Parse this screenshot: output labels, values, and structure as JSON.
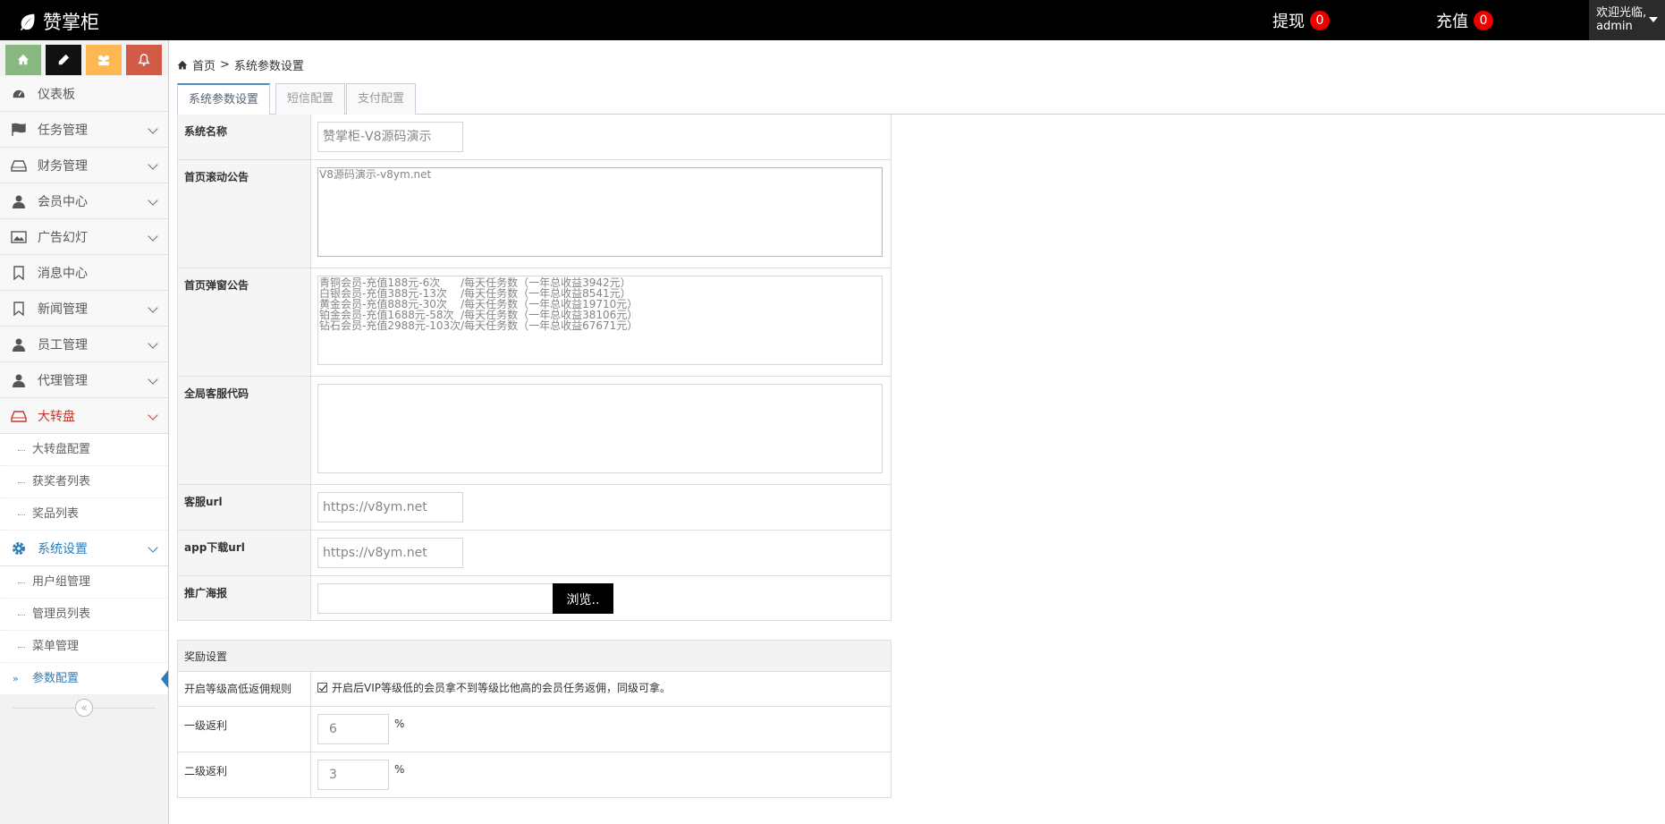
{
  "header": {
    "brand": "赞掌柜",
    "withdraw_label": "提现",
    "withdraw_count": "0",
    "recharge_label": "充值",
    "recharge_count": "0",
    "welcome": "欢迎光临,",
    "username": "admin"
  },
  "sidebar": {
    "items": [
      {
        "label": "仪表板",
        "icon": "dashboard-icon"
      },
      {
        "label": "任务管理",
        "icon": "flag-icon"
      },
      {
        "label": "财务管理",
        "icon": "hdd-icon"
      },
      {
        "label": "会员中心",
        "icon": "user-icon"
      },
      {
        "label": "广告幻灯",
        "icon": "picture-icon"
      },
      {
        "label": "消息中心",
        "icon": "bookmark-icon"
      },
      {
        "label": "新闻管理",
        "icon": "bookmark-icon"
      },
      {
        "label": "员工管理",
        "icon": "user-icon"
      },
      {
        "label": "代理管理",
        "icon": "user-icon"
      },
      {
        "label": "大转盘",
        "icon": "hdd-icon"
      },
      {
        "label": "系统设置",
        "icon": "gear-icon"
      }
    ],
    "wheel_sub": [
      "大转盘配置",
      "获奖者列表",
      "奖品列表"
    ],
    "system_sub": [
      "用户组管理",
      "管理员列表",
      "菜单管理",
      "参数配置"
    ],
    "arrow": "»",
    "collapse": "«"
  },
  "breadcrumb": {
    "home": "首页",
    "sep": ">",
    "current": "系统参数设置"
  },
  "tabs": [
    "系统参数设置",
    "短信配置",
    "支付配置"
  ],
  "form": {
    "system_name_label": "系统名称",
    "system_name_value": "赞掌柜-V8源码演示",
    "scroll_notice_label": "首页滚动公告",
    "scroll_notice_value": "V8源码演示-v8ym.net",
    "popup_notice_label": "首页弹窗公告",
    "popup_notice_value": "青铜会员-充值188元-6次      /每天任务数（一年总收益3942元）\n白银会员-充值388元-13次    /每天任务数（一年总收益8541元）\n黄金会员-充值888元-30次    /每天任务数（一年总收益19710元）\n铂金会员-充值1688元-58次  /每天任务数（一年总收益38106元）\n钻石会员-充值2988元-103次/每天任务数（一年总收益67671元）",
    "service_code_label": "全局客服代码",
    "service_code_value": "",
    "service_url_label": "客服url",
    "service_url_value": "https://v8ym.net",
    "app_url_label": "app下载url",
    "app_url_value": "https://v8ym.net",
    "poster_label": "推广海报",
    "browse_label": "浏览.."
  },
  "reward": {
    "section_title": "奖励设置",
    "rule_label": "开启等级高低返佣规则",
    "rule_text": "开启后VIP等级低的会员拿不到等级比他高的会员任务返佣，同级可拿。",
    "level1_label": "一级返利",
    "level1_value": "6",
    "level2_label": "二级返利",
    "level2_value": "3",
    "unit": "%"
  }
}
